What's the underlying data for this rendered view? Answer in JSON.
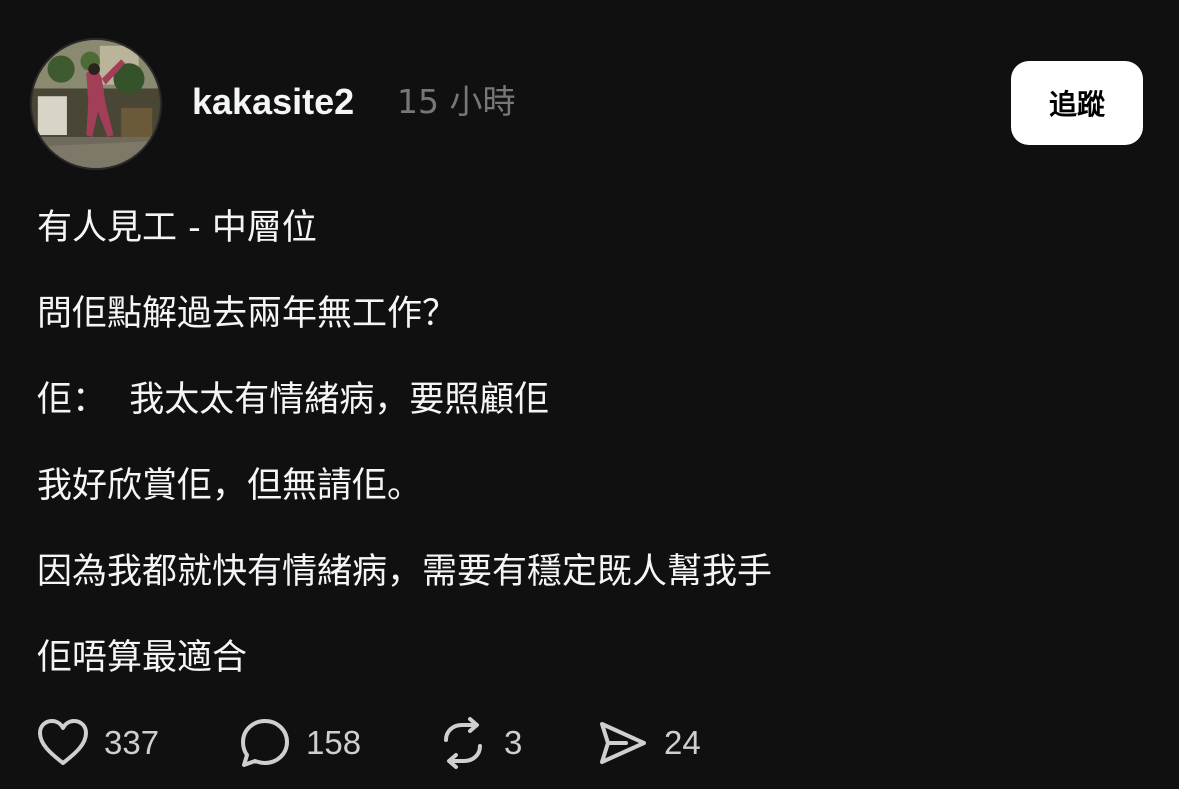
{
  "post": {
    "username": "kakasite2",
    "timestamp": "15 小時",
    "follow_label": "追蹤",
    "lines": [
      "有人見工 - 中層位",
      "問佢點解過去兩年無工作？",
      "佢：  我太太有情緒病，要照顧佢",
      "我好欣賞佢，但無請佢。",
      "因為我都就快有情緒病，需要有穩定既人幫我手",
      "佢唔算最適合"
    ],
    "actions": {
      "likes": "337",
      "comments": "158",
      "reposts": "3",
      "shares": "24"
    }
  },
  "icons": {
    "like": "heart-icon",
    "comment": "speech-bubble-icon",
    "repost": "repost-icon",
    "share": "send-icon"
  },
  "colors": {
    "background": "#101010",
    "text": "#f3f5f7",
    "muted": "#777777",
    "button_bg": "#ffffff"
  }
}
